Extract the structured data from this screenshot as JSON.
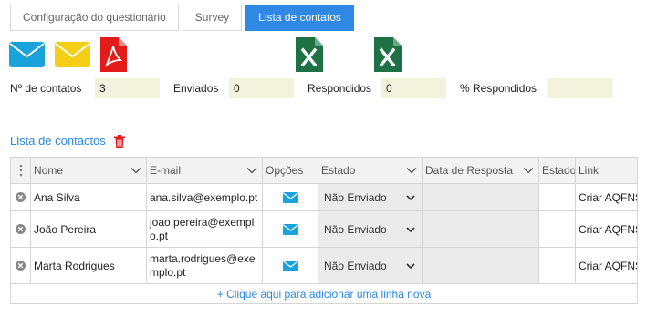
{
  "tabs": [
    {
      "label": "Configuração do questionário",
      "active": false
    },
    {
      "label": "Survey",
      "active": false
    },
    {
      "label": "Lista de contatos",
      "active": true
    }
  ],
  "toolbar_icons": [
    "envelope-icon",
    "envelope-icon",
    "pdf-icon",
    "excel-icon",
    "excel-icon"
  ],
  "stats": {
    "contacts_label": "Nº de contatos",
    "contacts_value": "3",
    "sent_label": "Enviados",
    "sent_value": "0",
    "responded_label": "Respondidos",
    "responded_value": "0",
    "pct_label": "% Respondidos",
    "pct_value": ""
  },
  "section": {
    "title": "Lista de contactos"
  },
  "table": {
    "columns": [
      "Nome",
      "E-mail",
      "Opções",
      "Estado",
      "Data de Resposta",
      "Estado",
      "Link"
    ],
    "rows": [
      {
        "nome": "Ana Silva",
        "email": "ana.silva@exemplo.pt",
        "estado": "Não Enviado",
        "data": "",
        "estado2": "",
        "link": "Criar AQFNS"
      },
      {
        "nome": "João Pereira",
        "email": "joao.pereira@exemplo.pt",
        "estado": "Não Enviado",
        "data": "",
        "estado2": "",
        "link": "Criar AQFNS"
      },
      {
        "nome": "Marta Rodrigues",
        "email": "marta.rodrigues@exemplo.pt",
        "estado": "Não Enviado",
        "data": "",
        "estado2": "",
        "link": "Criar AQFNS"
      }
    ],
    "add_row": "+ Clique aqui para adicionar uma linha nova"
  },
  "colors": {
    "accent": "#2f88e3",
    "excel": "#1e7145",
    "pdf": "#e31b1b",
    "envelope_yellow": "#f5cf16",
    "envelope_blue": "#1aa3db"
  }
}
